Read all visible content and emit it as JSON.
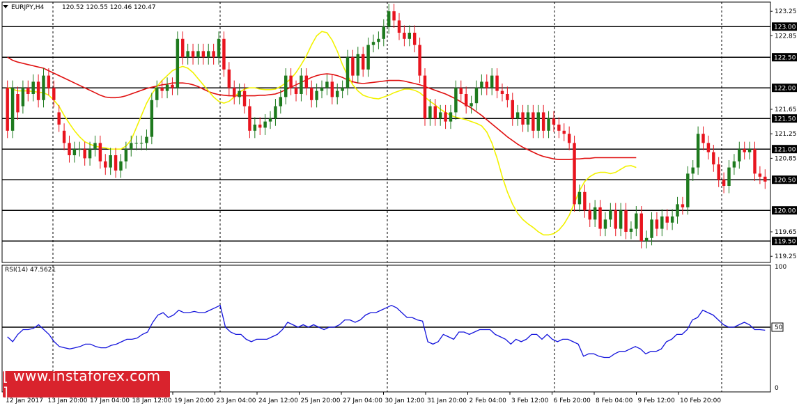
{
  "header": {
    "symbol": "EURJPY,H4",
    "ohlc": "120.52 120.55 120.46 120.47"
  },
  "rsi_header": "RSI(14) 47.5621",
  "watermark": "[ www.instaforex.com ]",
  "colors": {
    "bull": "#1e7a1e",
    "bear": "#e8141e",
    "ma_fast": "#f2f200",
    "ma_slow": "#e01010",
    "rsi": "#1414dc",
    "level": "#000000",
    "grid": "#000000"
  },
  "chart_data": [
    {
      "type": "candlestick",
      "title": "EURJPY,H4",
      "ylim": [
        119.15,
        123.4
      ],
      "y_ticks": [
        "123.25",
        "122.85",
        "122.50",
        "122.00",
        "121.65",
        "121.50",
        "121.25",
        "120.85",
        "120.50",
        "120.00",
        "119.65",
        "119.50",
        "119.25"
      ],
      "level_labels": [
        "123.00",
        "122.50",
        "122.00",
        "121.50",
        "121.00",
        "120.50",
        "120.00",
        "119.50"
      ],
      "x_labels": [
        "12 Jan 2017",
        "13 Jan 20:00",
        "17 Jan 04:00",
        "18 Jan 12:00",
        "19 Jan 20:00",
        "23 Jan 04:00",
        "24 Jan 12:00",
        "25 Jan 20:00",
        "27 Jan 04:00",
        "30 Jan 12:00",
        "31 Jan 20:00",
        "2 Feb 04:00",
        "3 Feb 12:00",
        "6 Feb 20:00",
        "8 Feb 04:00",
        "9 Feb 12:00",
        "10 Feb 20:00"
      ],
      "day_separators": [
        1,
        9,
        38,
        46,
        93,
        101,
        125,
        133,
        159
      ],
      "moving_average_fast": [
        122.0,
        121.98,
        121.95,
        121.95,
        121.95,
        121.94,
        121.93,
        121.92,
        121.88,
        121.8,
        121.7,
        121.55,
        121.42,
        121.3,
        121.2,
        121.12,
        121.08,
        121.05,
        121.03,
        121.02,
        121.0,
        121.0,
        121.0,
        121.05,
        121.15,
        121.35,
        121.55,
        121.75,
        121.9,
        122.02,
        122.12,
        122.2,
        122.28,
        122.32,
        122.35,
        122.32,
        122.25,
        122.15,
        122.05,
        121.95,
        121.85,
        121.78,
        121.75,
        121.78,
        121.85,
        121.93,
        121.98,
        122.0,
        122.0,
        121.98,
        121.97,
        121.97,
        121.98,
        122.02,
        122.08,
        122.15,
        122.25,
        122.38,
        122.52,
        122.7,
        122.85,
        122.92,
        122.9,
        122.78,
        122.6,
        122.38,
        122.2,
        122.05,
        121.95,
        121.88,
        121.85,
        121.83,
        121.82,
        121.85,
        121.88,
        121.92,
        121.95,
        121.98,
        121.98,
        121.96,
        121.92,
        121.85,
        121.78,
        121.72,
        121.65,
        121.6,
        121.55,
        121.52,
        121.5,
        121.48,
        121.45,
        121.42,
        121.38,
        121.28,
        121.1,
        120.85,
        120.55,
        120.3,
        120.1,
        119.95,
        119.85,
        119.78,
        119.72,
        119.65,
        119.6,
        119.6,
        119.62,
        119.68,
        119.78,
        119.92,
        120.12,
        120.32,
        120.47,
        120.55,
        120.6,
        120.62,
        120.62,
        120.6,
        120.62,
        120.67,
        120.72,
        120.73,
        120.7
      ],
      "moving_average_slow": [
        122.5,
        122.45,
        122.42,
        122.4,
        122.38,
        122.36,
        122.34,
        122.32,
        122.28,
        122.24,
        122.2,
        122.16,
        122.12,
        122.08,
        122.04,
        122.0,
        121.96,
        121.92,
        121.88,
        121.85,
        121.84,
        121.84,
        121.85,
        121.87,
        121.9,
        121.93,
        121.96,
        121.99,
        122.01,
        122.03,
        122.05,
        122.06,
        122.08,
        122.08,
        122.08,
        122.07,
        122.05,
        122.02,
        121.98,
        121.94,
        121.91,
        121.89,
        121.88,
        121.87,
        121.87,
        121.87,
        121.87,
        121.87,
        121.87,
        121.88,
        121.88,
        121.89,
        121.9,
        121.93,
        121.97,
        122.01,
        122.05,
        122.09,
        122.13,
        122.17,
        122.2,
        122.22,
        122.23,
        122.22,
        122.2,
        122.17,
        122.13,
        122.1,
        122.08,
        122.07,
        122.08,
        122.09,
        122.1,
        122.11,
        122.12,
        122.12,
        122.12,
        122.11,
        122.09,
        122.07,
        122.05,
        122.02,
        121.99,
        121.96,
        121.93,
        121.9,
        121.86,
        121.82,
        121.77,
        121.72,
        121.67,
        121.61,
        121.55,
        121.48,
        121.41,
        121.34,
        121.27,
        121.2,
        121.14,
        121.08,
        121.03,
        120.99,
        120.95,
        120.91,
        120.88,
        120.86,
        120.84,
        120.83,
        120.83,
        120.83,
        120.84,
        120.84,
        120.85,
        120.85,
        120.86,
        120.86,
        120.86,
        120.86,
        120.86,
        120.86,
        120.86,
        120.86,
        120.86
      ],
      "candles": [
        [
          122.0,
          121.3
        ],
        [
          121.3,
          122.0
        ],
        [
          121.9,
          121.6
        ],
        [
          121.7,
          122.0
        ],
        [
          122.0,
          121.9
        ],
        [
          121.9,
          122.1
        ],
        [
          122.1,
          121.8
        ],
        [
          121.8,
          122.2
        ],
        [
          122.2,
          122.0
        ],
        [
          122.0,
          121.8
        ],
        [
          121.6,
          121.4
        ],
        [
          121.3,
          121.1
        ],
        [
          121.1,
          120.9
        ],
        [
          120.9,
          121.0
        ],
        [
          121.0,
          121.0
        ],
        [
          121.0,
          120.85
        ],
        [
          120.85,
          121.0
        ],
        [
          121.0,
          121.1
        ],
        [
          121.1,
          120.8
        ],
        [
          120.8,
          120.7
        ],
        [
          120.7,
          120.9
        ],
        [
          120.9,
          120.65
        ],
        [
          120.65,
          120.8
        ],
        [
          120.8,
          121.0
        ],
        [
          121.0,
          121.1
        ],
        [
          121.1,
          121.1
        ],
        [
          121.1,
          121.1
        ],
        [
          121.1,
          121.2
        ],
        [
          121.2,
          121.8
        ],
        [
          121.8,
          122.0
        ],
        [
          122.0,
          121.95
        ],
        [
          121.95,
          122.05
        ],
        [
          122.05,
          122.0
        ],
        [
          122.0,
          122.8
        ],
        [
          122.8,
          122.5
        ],
        [
          122.5,
          122.6
        ],
        [
          122.6,
          122.5
        ],
        [
          122.5,
          122.6
        ],
        [
          122.6,
          122.5
        ],
        [
          122.5,
          122.6
        ],
        [
          122.6,
          122.5
        ],
        [
          122.5,
          122.8
        ],
        [
          122.8,
          122.3
        ],
        [
          122.3,
          122.0
        ],
        [
          122.0,
          121.85
        ],
        [
          121.85,
          121.95
        ],
        [
          121.95,
          121.7
        ],
        [
          121.7,
          121.3
        ],
        [
          121.3,
          121.4
        ],
        [
          121.4,
          121.35
        ],
        [
          121.35,
          121.45
        ],
        [
          121.45,
          121.5
        ],
        [
          121.5,
          121.7
        ],
        [
          121.7,
          121.85
        ],
        [
          121.85,
          122.2
        ],
        [
          122.2,
          122.0
        ],
        [
          122.0,
          121.9
        ],
        [
          121.9,
          122.2
        ],
        [
          122.2,
          122.0
        ],
        [
          122.0,
          121.8
        ],
        [
          121.8,
          121.95
        ],
        [
          121.95,
          122.0
        ],
        [
          122.0,
          122.1
        ],
        [
          122.1,
          121.85
        ],
        [
          121.85,
          121.95
        ],
        [
          121.95,
          122.0
        ],
        [
          122.0,
          122.5
        ],
        [
          122.5,
          122.2
        ],
        [
          122.2,
          122.55
        ],
        [
          122.55,
          122.3
        ],
        [
          122.3,
          122.7
        ],
        [
          122.7,
          122.75
        ],
        [
          122.75,
          122.8
        ],
        [
          122.8,
          123.0
        ],
        [
          123.0,
          123.25
        ],
        [
          123.25,
          123.1
        ],
        [
          123.1,
          122.9
        ],
        [
          122.9,
          122.8
        ],
        [
          122.8,
          122.9
        ],
        [
          122.9,
          122.7
        ],
        [
          122.7,
          122.2
        ],
        [
          122.2,
          121.5
        ],
        [
          121.5,
          121.7
        ],
        [
          121.7,
          121.5
        ],
        [
          121.5,
          121.6
        ],
        [
          121.6,
          121.45
        ],
        [
          121.45,
          121.6
        ],
        [
          121.6,
          122.0
        ],
        [
          122.0,
          121.9
        ],
        [
          121.9,
          121.7
        ],
        [
          121.7,
          121.75
        ],
        [
          121.75,
          122.0
        ],
        [
          122.0,
          122.1
        ],
        [
          122.1,
          122.0
        ],
        [
          122.0,
          122.2
        ],
        [
          122.2,
          121.95
        ],
        [
          121.95,
          121.9
        ],
        [
          121.9,
          121.8
        ],
        [
          121.8,
          121.5
        ],
        [
          121.5,
          121.6
        ],
        [
          121.6,
          121.4
        ],
        [
          121.4,
          121.6
        ],
        [
          121.6,
          121.3
        ],
        [
          121.3,
          121.6
        ],
        [
          121.6,
          121.3
        ],
        [
          121.3,
          121.5
        ],
        [
          121.5,
          121.4
        ],
        [
          121.4,
          121.3
        ],
        [
          121.3,
          121.25
        ],
        [
          121.25,
          121.1
        ],
        [
          121.1,
          120.1
        ],
        [
          120.1,
          120.3
        ],
        [
          120.3,
          120.0
        ],
        [
          120.0,
          119.85
        ],
        [
          119.85,
          120.05
        ],
        [
          120.05,
          119.7
        ],
        [
          119.7,
          119.85
        ],
        [
          119.85,
          120.0
        ],
        [
          120.0,
          119.7
        ],
        [
          119.7,
          120.0
        ],
        [
          120.0,
          119.65
        ],
        [
          119.65,
          119.7
        ],
        [
          119.7,
          119.95
        ],
        [
          119.95,
          119.5
        ],
        [
          119.5,
          119.55
        ],
        [
          119.55,
          119.85
        ],
        [
          119.85,
          119.7
        ],
        [
          119.7,
          119.9
        ],
        [
          119.9,
          119.8
        ],
        [
          119.8,
          119.9
        ],
        [
          119.9,
          120.1
        ],
        [
          120.1,
          120.05
        ],
        [
          120.05,
          120.6
        ],
        [
          120.6,
          120.7
        ],
        [
          120.7,
          121.25
        ],
        [
          121.25,
          121.1
        ],
        [
          121.1,
          120.95
        ],
        [
          120.95,
          120.75
        ],
        [
          120.75,
          120.5
        ],
        [
          120.5,
          120.4
        ],
        [
          120.4,
          120.7
        ],
        [
          120.7,
          120.8
        ],
        [
          120.8,
          121.0
        ],
        [
          121.0,
          120.95
        ],
        [
          120.95,
          121.0
        ],
        [
          121.0,
          120.6
        ],
        [
          120.6,
          120.55
        ],
        [
          120.55,
          120.47
        ]
      ]
    },
    {
      "type": "line",
      "title": "RSI(14) 47.5621",
      "ylim": [
        0,
        100
      ],
      "y_ticks": [
        "100",
        "50",
        "0"
      ],
      "reference_line": 50,
      "values": [
        42,
        38,
        44,
        48,
        48,
        49,
        52,
        48,
        44,
        38,
        34,
        33,
        32,
        33,
        34,
        36,
        36,
        34,
        33,
        33,
        35,
        36,
        38,
        40,
        40,
        41,
        44,
        46,
        54,
        60,
        62,
        58,
        60,
        64,
        62,
        62,
        63,
        62,
        62,
        64,
        66,
        68,
        50,
        46,
        44,
        44,
        40,
        38,
        40,
        40,
        40,
        42,
        44,
        48,
        54,
        52,
        50,
        52,
        50,
        52,
        50,
        48,
        50,
        50,
        52,
        56,
        56,
        54,
        56,
        60,
        62,
        62,
        64,
        66,
        68,
        66,
        62,
        58,
        58,
        56,
        55,
        38,
        36,
        38,
        44,
        42,
        40,
        46,
        46,
        44,
        46,
        48,
        48,
        48,
        44,
        42,
        40,
        36,
        40,
        38,
        40,
        44,
        44,
        40,
        44,
        40,
        38,
        40,
        40,
        38,
        36,
        26,
        28,
        28,
        26,
        25,
        25,
        28,
        30,
        30,
        32,
        34,
        32,
        28,
        30,
        30,
        32,
        38,
        40,
        44,
        44,
        48,
        56,
        58,
        64,
        62,
        60,
        56,
        52,
        50,
        50,
        52,
        54,
        52,
        48,
        48,
        47.5
      ],
      "x_range": "same as price panel"
    }
  ]
}
